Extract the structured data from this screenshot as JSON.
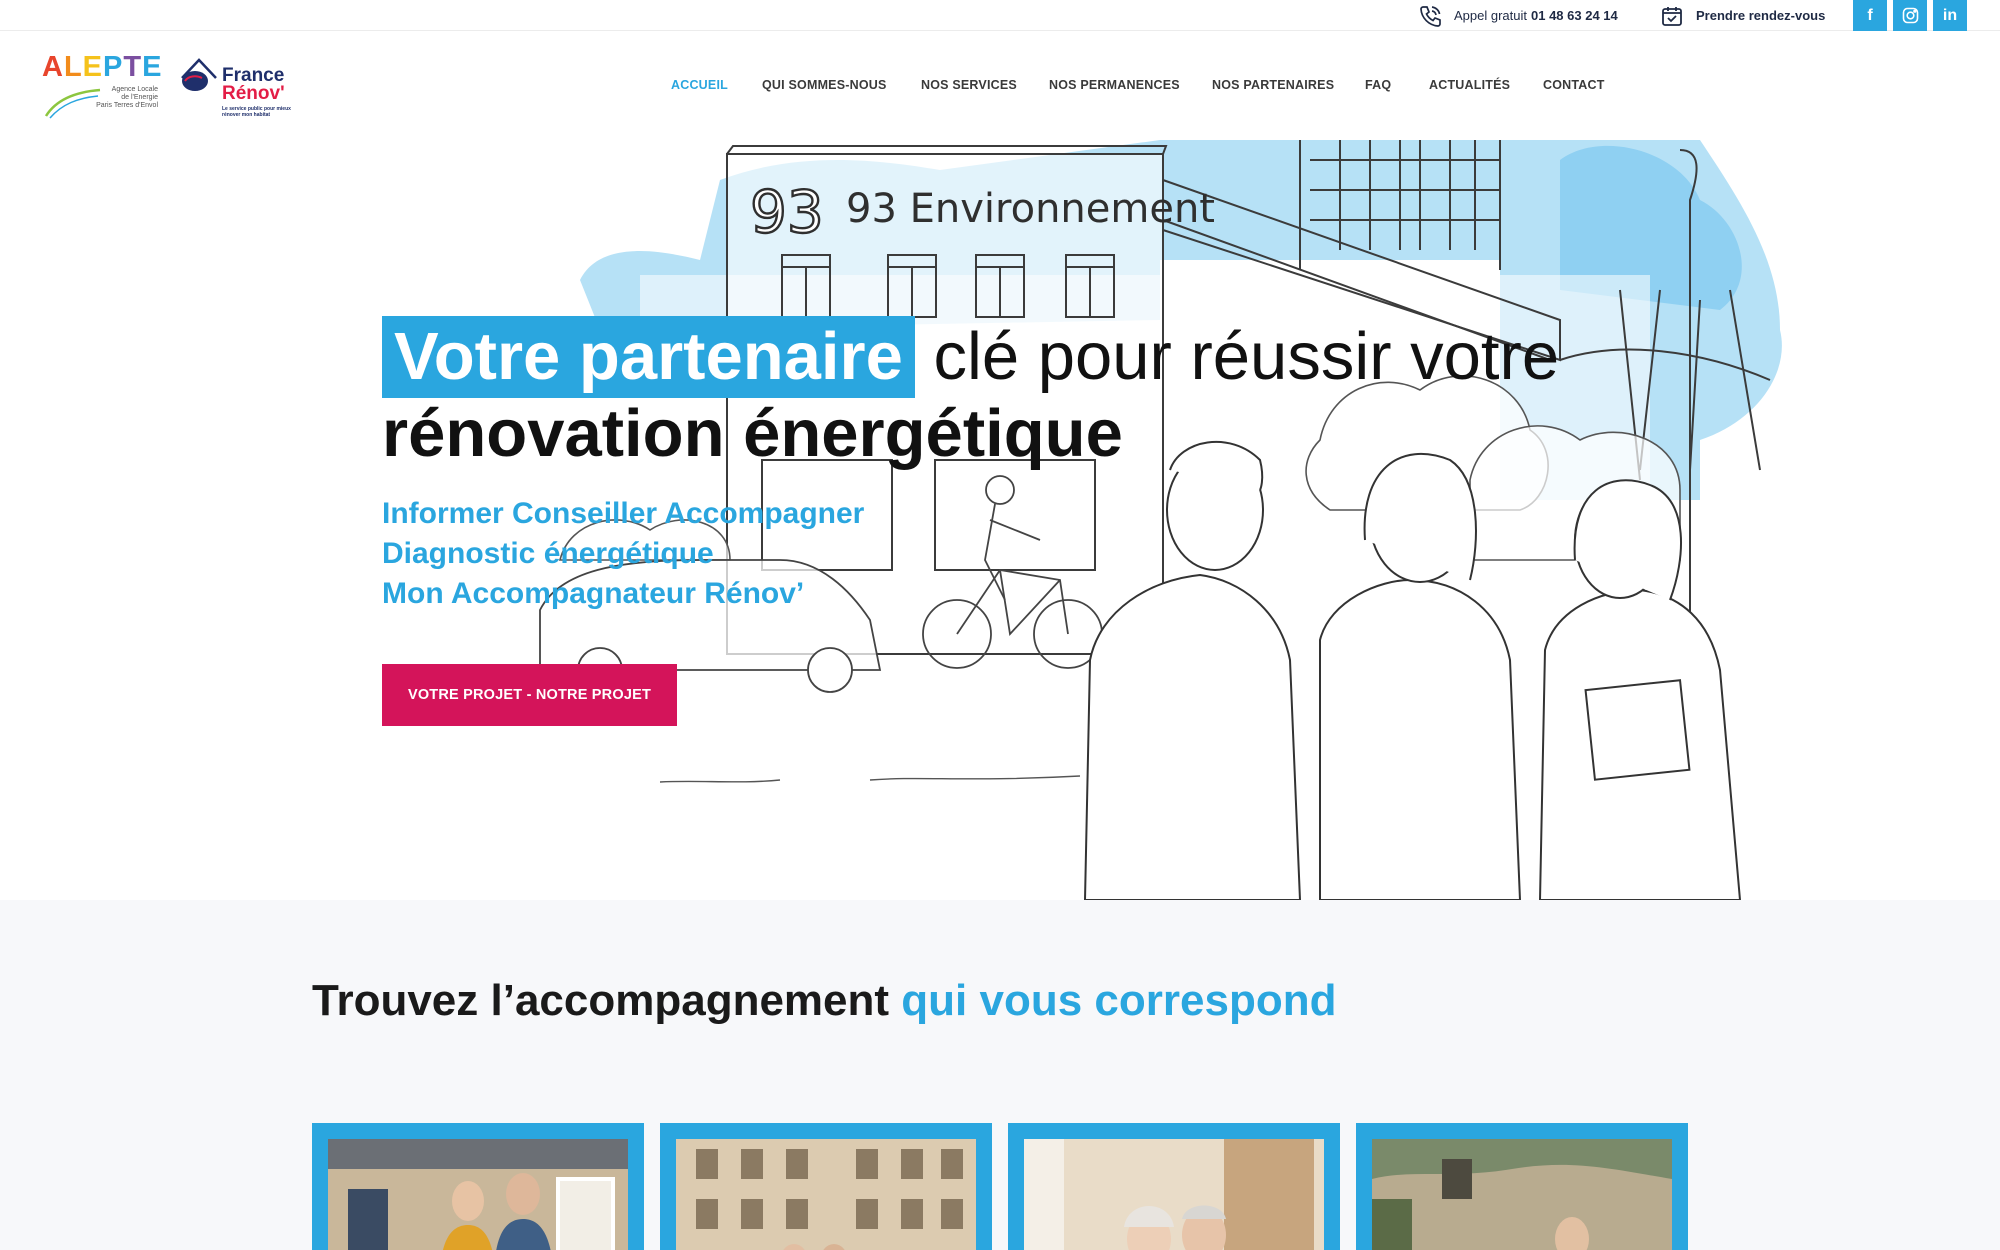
{
  "topbar": {
    "phone_prefix": "Appel gratuit",
    "phone_number": "01 48 63 24 14",
    "appointment": "Prendre rendez-vous",
    "social": [
      {
        "name": "facebook-icon",
        "glyph": "f"
      },
      {
        "name": "instagram-icon",
        "glyph": "◎"
      },
      {
        "name": "linkedin-icon",
        "glyph": "in"
      }
    ],
    "accent_color": "#2aa6df"
  },
  "logos": {
    "alepte_word": [
      "A",
      "L",
      "E",
      "P",
      "T",
      "E"
    ],
    "alepte_sub": [
      "Agence Locale",
      "de l'Energie",
      "Paris Terres d'Envol"
    ],
    "france_renov_line1": "France",
    "france_renov_line2": "Rénov'",
    "france_renov_tagline": "Le service public pour mieux rénover mon habitat"
  },
  "nav": {
    "items": [
      {
        "label": "ACCUEIL",
        "active": true
      },
      {
        "label": "QUI SOMMES-NOUS",
        "active": false
      },
      {
        "label": "NOS SERVICES",
        "active": false
      },
      {
        "label": "NOS PERMANENCES",
        "active": false
      },
      {
        "label": "NOS PARTENAIRES",
        "active": false
      },
      {
        "label": "FAQ",
        "active": false
      },
      {
        "label": "ACTUALITÉS",
        "active": false
      },
      {
        "label": "CONTACT",
        "active": false
      }
    ]
  },
  "hero": {
    "title_highlight": "Votre partenaire",
    "title_rest": " clé pour réussir votre",
    "title_line2": "rénovation énergétique",
    "subtitle_lines": [
      "Informer Conseiller Accompagner",
      "Diagnostic énergétique",
      "Mon Accompagnateur Rénov’"
    ],
    "cta_label": "VOTRE PROJET - NOTRE PROJET",
    "illustration_sign": "93 Environnement",
    "cta_color": "#d4145a"
  },
  "section2": {
    "title_dark": "Trouvez l’accompagnement ",
    "title_blue": "qui vous correspond",
    "cards": [
      {
        "name": "card-couple-house"
      },
      {
        "name": "card-apartment-building"
      },
      {
        "name": "card-senior-couple"
      },
      {
        "name": "card-old-house"
      }
    ]
  }
}
